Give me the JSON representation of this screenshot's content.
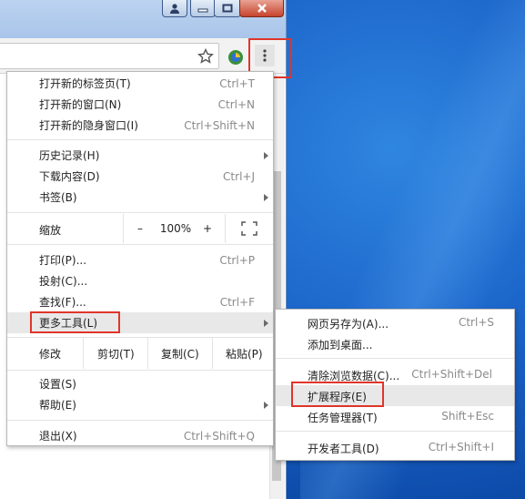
{
  "colors": {
    "highlight": "#e0352b",
    "desktop": "#1b64c9",
    "menu_hover": "#e8e8e8",
    "shortcut": "#8a8a8a"
  },
  "titlebar": {
    "buttons": [
      "user-icon",
      "minimize-icon",
      "maximize-icon",
      "close-icon"
    ]
  },
  "toolbar": {
    "star_icon": "star-icon",
    "extension_icon": "extension-icon",
    "menu_icon": "vertical-dots-icon"
  },
  "menu": {
    "new_tab": {
      "label": "打开新的标签页(T)",
      "shortcut": "Ctrl+T"
    },
    "new_window": {
      "label": "打开新的窗口(N)",
      "shortcut": "Ctrl+N"
    },
    "new_incognito": {
      "label": "打开新的隐身窗口(I)",
      "shortcut": "Ctrl+Shift+N"
    },
    "history": {
      "label": "历史记录(H)"
    },
    "downloads": {
      "label": "下载内容(D)",
      "shortcut": "Ctrl+J"
    },
    "bookmarks": {
      "label": "书签(B)"
    },
    "zoom": {
      "label": "缩放",
      "minus": "–",
      "value": "100%",
      "plus": "+"
    },
    "print": {
      "label": "打印(P)...",
      "shortcut": "Ctrl+P"
    },
    "cast": {
      "label": "投射(C)..."
    },
    "find": {
      "label": "查找(F)...",
      "shortcut": "Ctrl+F"
    },
    "more_tools": {
      "label": "更多工具(L)"
    },
    "edit": {
      "label": "修改",
      "cut": "剪切(T)",
      "copy": "复制(C)",
      "paste": "粘贴(P)"
    },
    "settings": {
      "label": "设置(S)"
    },
    "help": {
      "label": "帮助(E)"
    },
    "exit": {
      "label": "退出(X)",
      "shortcut": "Ctrl+Shift+Q"
    }
  },
  "submenu": {
    "save_page": {
      "label": "网页另存为(A)...",
      "shortcut": "Ctrl+S"
    },
    "add_to_desktop": {
      "label": "添加到桌面..."
    },
    "clear_data": {
      "label": "清除浏览数据(C)...",
      "shortcut": "Ctrl+Shift+Del"
    },
    "extensions": {
      "label": "扩展程序(E)"
    },
    "task_manager": {
      "label": "任务管理器(T)",
      "shortcut": "Shift+Esc"
    },
    "dev_tools": {
      "label": "开发者工具(D)",
      "shortcut": "Ctrl+Shift+I"
    }
  }
}
